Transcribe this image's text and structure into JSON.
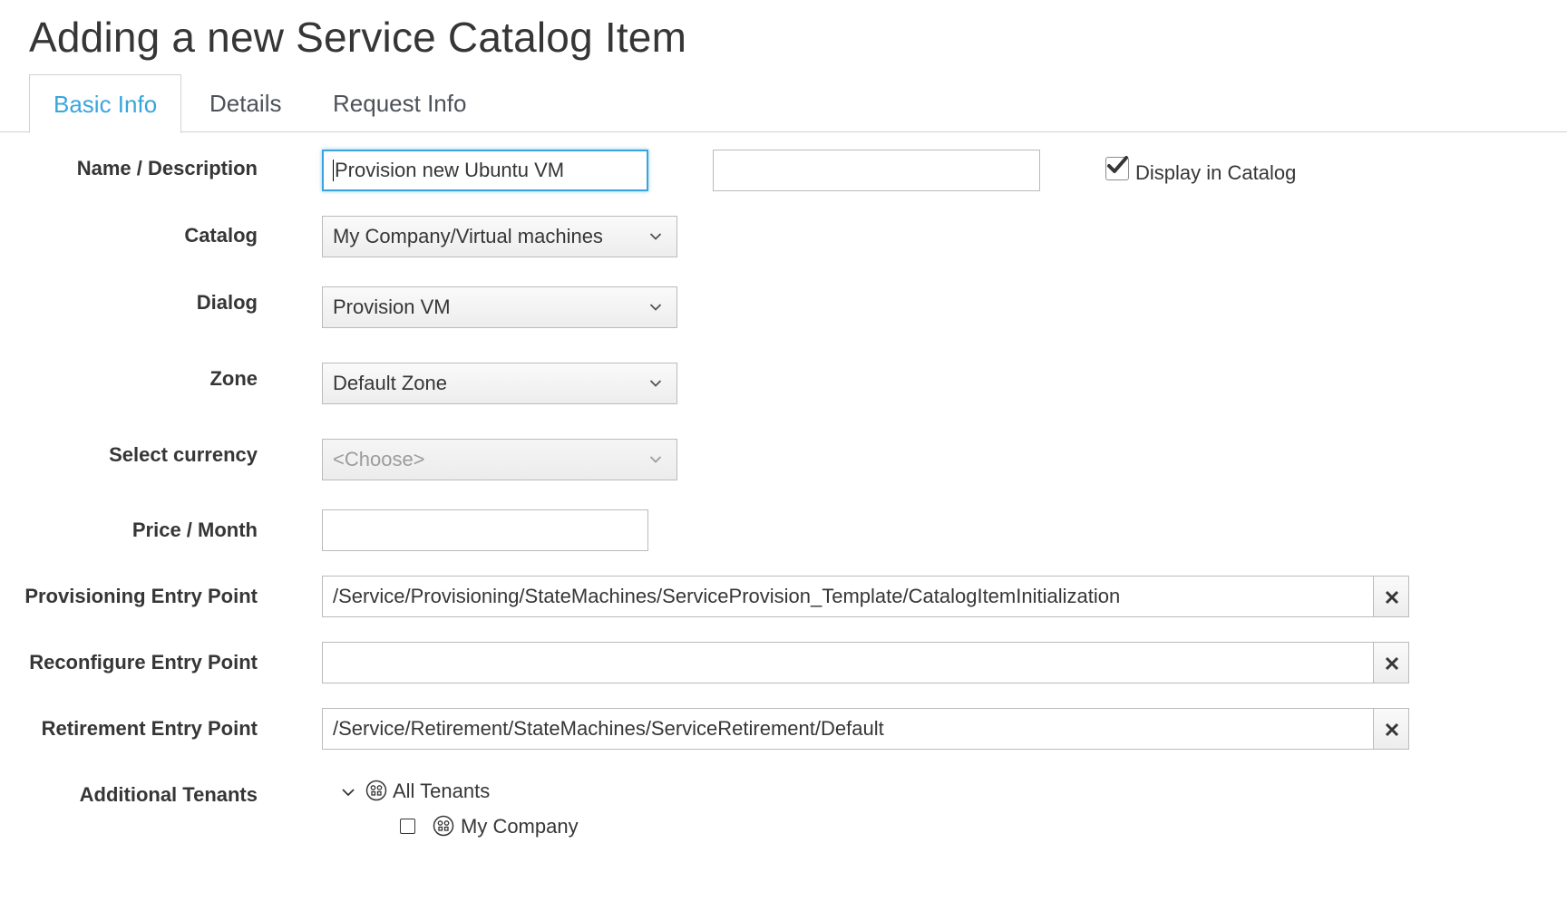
{
  "page": {
    "title": "Adding a new Service Catalog Item"
  },
  "tabs": [
    {
      "label": "Basic Info",
      "active": true
    },
    {
      "label": "Details",
      "active": false
    },
    {
      "label": "Request Info",
      "active": false
    }
  ],
  "form": {
    "name_description": {
      "label": "Name / Description",
      "name_value": "Provision new Ubuntu VM",
      "description_value": ""
    },
    "display_in_catalog": {
      "label": "Display in Catalog",
      "checked": true
    },
    "catalog": {
      "label": "Catalog",
      "value": "My Company/Virtual machines"
    },
    "dialog": {
      "label": "Dialog",
      "value": "Provision VM"
    },
    "zone": {
      "label": "Zone",
      "value": "Default Zone"
    },
    "currency": {
      "label": "Select currency",
      "value": "<Choose>",
      "disabled": true
    },
    "price": {
      "label": "Price / Month",
      "value": ""
    },
    "provisioning_entry_point": {
      "label": "Provisioning Entry Point",
      "value": "/Service/Provisioning/StateMachines/ServiceProvision_Template/CatalogItemInitialization"
    },
    "reconfigure_entry_point": {
      "label": "Reconfigure Entry Point",
      "value": ""
    },
    "retirement_entry_point": {
      "label": "Retirement Entry Point",
      "value": "/Service/Retirement/StateMachines/ServiceRetirement/Default"
    },
    "additional_tenants": {
      "label": "Additional Tenants",
      "tree": {
        "root": "All Tenants",
        "children": [
          {
            "label": "My Company",
            "checked": false
          }
        ]
      }
    }
  },
  "icons": {
    "chevron": "chevron-down-icon",
    "clear": "close-icon",
    "tenant": "tenant-icon",
    "checkmark": "checkmark-icon"
  },
  "colors": {
    "accent": "#39a5dc",
    "text": "#363636",
    "border": "#bbbbbb"
  }
}
